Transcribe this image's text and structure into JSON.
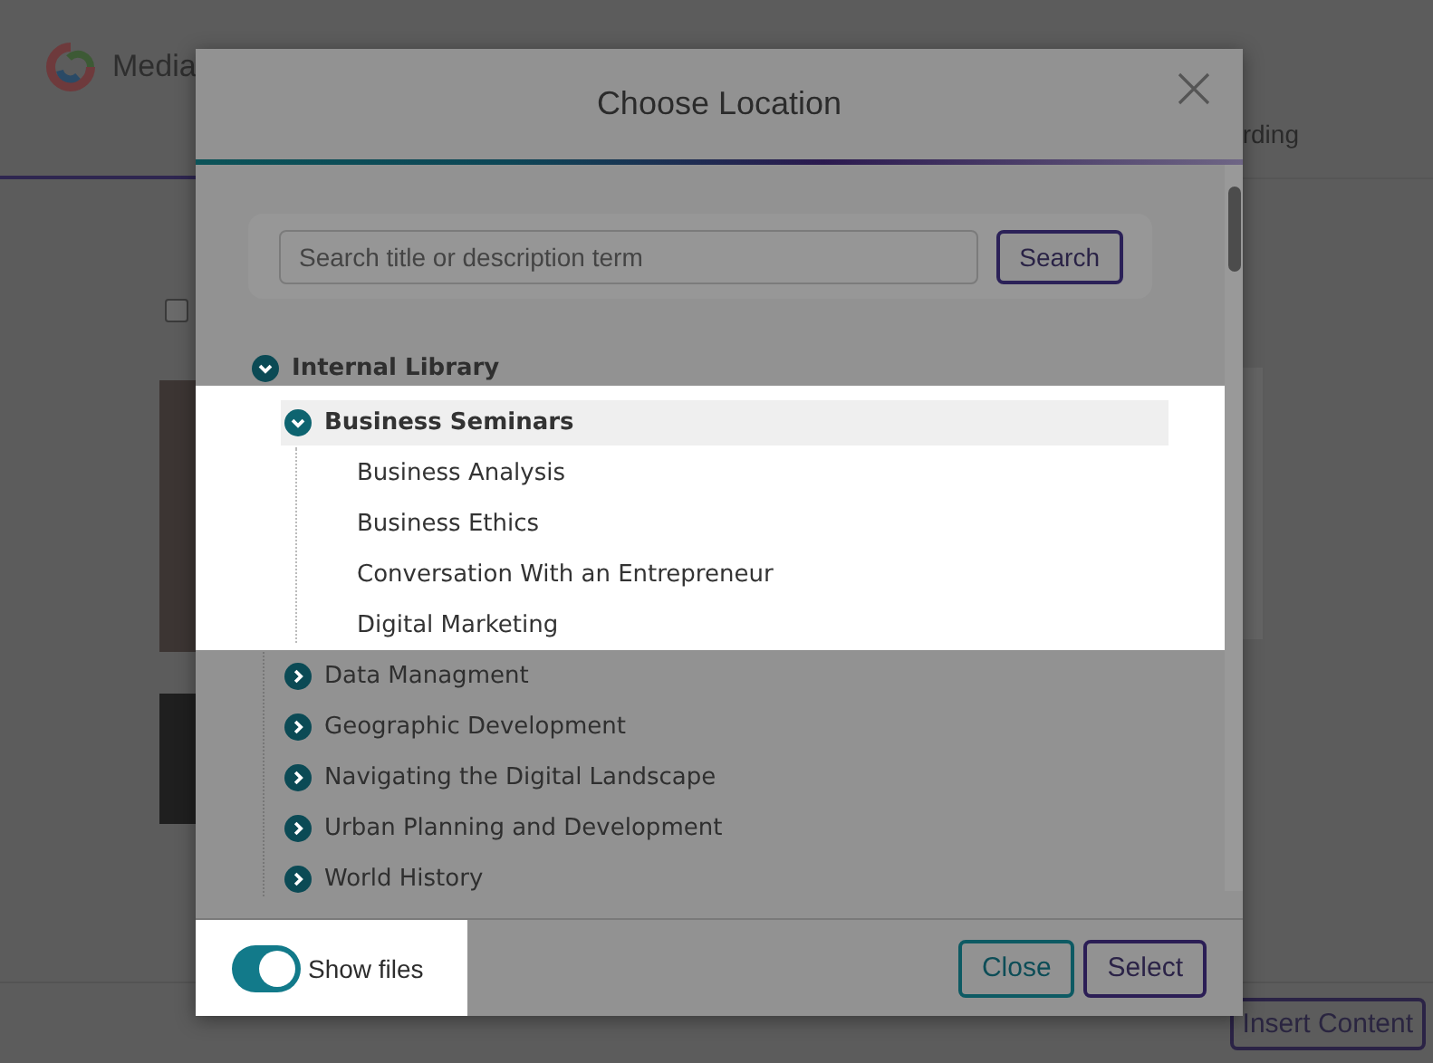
{
  "app": {
    "logo_text": "Media",
    "tab_text": "rding",
    "checkbox": {
      "checked": false
    },
    "insert_button": "Insert Content"
  },
  "dialog": {
    "title": "Choose Location",
    "search": {
      "placeholder": "Search title or description term",
      "button": "Search"
    },
    "tree": [
      {
        "label": "Internal Library",
        "expanded": true,
        "selected": false,
        "spotlight": false,
        "children": [
          {
            "label": "Business Seminars",
            "expanded": true,
            "selected": true,
            "spotlight": true,
            "children": [
              {
                "label": "Business Analysis",
                "selected": false
              },
              {
                "label": "Business Ethics",
                "selected": false
              },
              {
                "label": "Conversation With an Entrepreneur",
                "selected": false
              },
              {
                "label": "Digital Marketing",
                "selected": false
              }
            ]
          },
          {
            "label": "Data Managment",
            "expanded": false,
            "selected": false,
            "spotlight": false
          },
          {
            "label": "Geographic Development",
            "expanded": false,
            "selected": false,
            "spotlight": false
          },
          {
            "label": "Navigating the Digital Landscape",
            "expanded": false,
            "selected": false,
            "spotlight": false
          },
          {
            "label": "Urban Planning and Development",
            "expanded": false,
            "selected": false,
            "spotlight": false
          },
          {
            "label": "World History",
            "expanded": false,
            "selected": false,
            "spotlight": false
          }
        ]
      }
    ],
    "show_files": {
      "label": "Show files",
      "on": true,
      "spotlight": true
    },
    "buttons": [
      {
        "label": "Close",
        "kind": "secondary"
      },
      {
        "label": "Select",
        "kind": "primary"
      }
    ]
  }
}
